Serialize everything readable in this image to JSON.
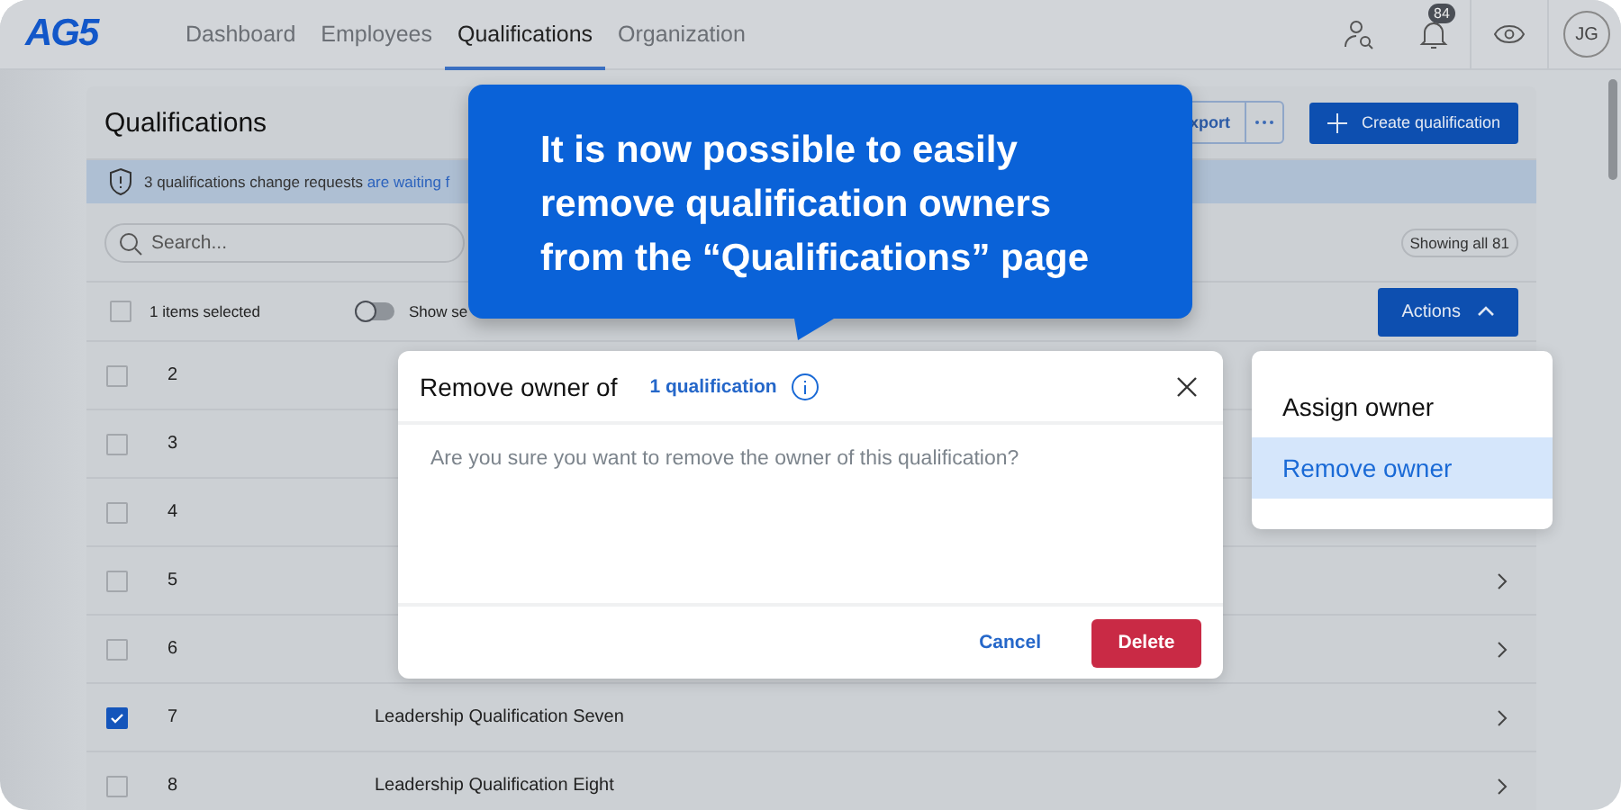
{
  "nav": {
    "logo": "AG5",
    "tabs": [
      {
        "label": "Dashboard",
        "selected": false
      },
      {
        "label": "Employees",
        "selected": false
      },
      {
        "label": "Qualifications",
        "selected": true
      },
      {
        "label": "Organization",
        "selected": false
      }
    ],
    "notifications": "84",
    "avatar": "JG"
  },
  "card": {
    "title": "Qualifications",
    "export_label": "xport",
    "create_label": "Create qualification",
    "banner": {
      "text": "3 qualifications change requests ",
      "link": "are waiting f"
    },
    "search": {
      "placeholder": "Search..."
    },
    "count": "Showing all 81",
    "selection": {
      "checked": false,
      "label": "1 items selected",
      "toggle_on": false,
      "toggle_label": "Show se"
    },
    "actions": {
      "label": "Actions",
      "expanded": true
    },
    "rows": [
      {
        "number": "2",
        "checked": false,
        "chevron": false
      },
      {
        "number": "3",
        "checked": false,
        "chevron": false
      },
      {
        "number": "4",
        "checked": false,
        "chevron": false
      },
      {
        "number": "5",
        "checked": false,
        "chevron": true
      },
      {
        "number": "6",
        "checked": false,
        "chevron": true
      },
      {
        "number": "7",
        "checked": true,
        "name": "Leadership Qualification Seven",
        "chevron": true
      },
      {
        "number": "8",
        "checked": false,
        "name": "Leadership Qualification Eight",
        "chevron": true
      }
    ]
  },
  "callout": {
    "lines": [
      "It is now possible to easily",
      "remove qualification owners",
      "from the “Qualifications” page"
    ]
  },
  "dialog": {
    "title": "Remove owner of",
    "link": "1 qualification",
    "body": "Are you sure you want to remove the owner of this qualification?",
    "cancel": "Cancel",
    "confirm": "Delete"
  },
  "menu": {
    "items": [
      {
        "label": "Assign owner",
        "selected": false
      },
      {
        "label": "Remove owner",
        "selected": true
      }
    ]
  }
}
